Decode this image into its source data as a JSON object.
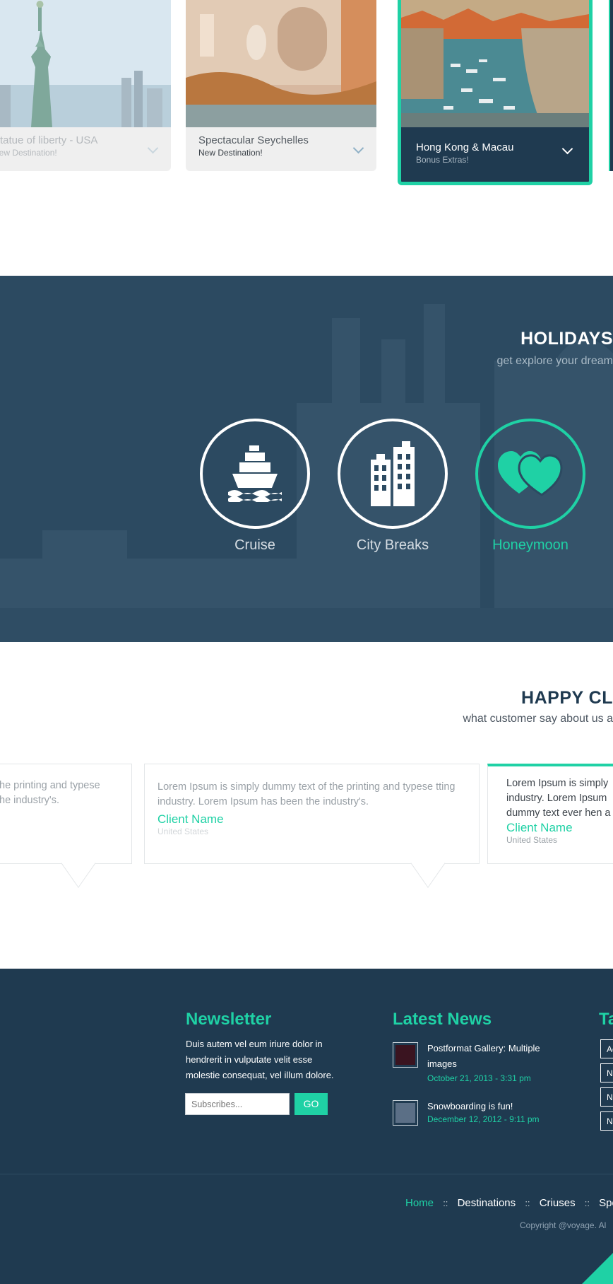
{
  "destinations": [
    {
      "title": "Statue of liberty - USA",
      "subtitle": "New Destination!",
      "state": "faded"
    },
    {
      "title": "Spectacular Seychelles",
      "subtitle": "New Destination!",
      "state": "normal"
    },
    {
      "title": "Hong Kong & Macau",
      "subtitle": "Bonus Extras!",
      "state": "active"
    }
  ],
  "holidays": {
    "title": "HOLIDAYS",
    "subtitle": "get explore your dream",
    "categories": [
      {
        "label": "Cruise",
        "icon": "ship-icon"
      },
      {
        "label": "City Breaks",
        "icon": "buildings-icon"
      },
      {
        "label": "Honeymoon",
        "icon": "hearts-icon"
      }
    ]
  },
  "happy": {
    "title": "HAPPY CL",
    "subtitle": "what customer say about us a",
    "testimonials": [
      {
        "text": "he printing and typese\nhe industry's.",
        "name": "",
        "location": ""
      },
      {
        "text": "Lorem Ipsum is simply dummy text of the printing and typese tting industry. Lorem Ipsum has been the industry's.",
        "name": "Client Name",
        "location": "United States"
      },
      {
        "text": "Lorem Ipsum is simply industry. Lorem Ipsum dummy text ever hen a",
        "name": "Client Name",
        "location": "United States"
      }
    ]
  },
  "footer": {
    "newsletter": {
      "heading": "Newsletter",
      "text": "Duis autem vel eum iriure dolor in hendrerit in vulputate velit esse molestie consequat, vel illum dolore.",
      "placeholder": "Subscribes...",
      "button": "GO"
    },
    "news": {
      "heading": "Latest News",
      "items": [
        {
          "title": "Postformat Gallery: Multiple images",
          "date": "October 21, 2013 - 3:31 pm"
        },
        {
          "title": "Snowboarding is fun!",
          "date": "December 12, 2012 - 9:11 pm"
        }
      ]
    },
    "tags": {
      "heading": "Ta",
      "items": [
        "Ac",
        "N",
        "Ne",
        "N"
      ]
    },
    "nav": [
      "Home",
      "Destinations",
      "Criuses",
      "Spec"
    ],
    "nav_separator": "::",
    "copyright": "Copyright @voyage. Al"
  },
  "colors": {
    "accent": "#1fd1a5",
    "navy": "#1f3a50",
    "section_bg": "#2c4a61"
  }
}
